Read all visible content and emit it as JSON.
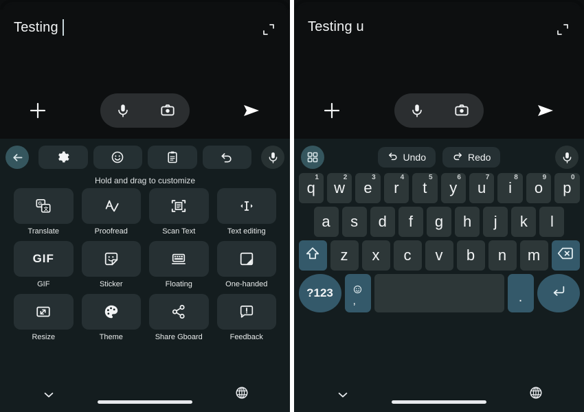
{
  "panels": {
    "left": {
      "compose": {
        "text": "Testing",
        "expand_icon": "expand-diagonal-icon",
        "plus_icon": "plus-icon",
        "mic_icon": "microphone-icon",
        "camera_icon": "camera-icon",
        "send_icon": "send-arrow-icon"
      },
      "toolbar": {
        "back_icon": "arrow-back-icon",
        "items": [
          {
            "icon": "gear-icon",
            "name": "settings"
          },
          {
            "icon": "emoji-icon",
            "name": "emoji"
          },
          {
            "icon": "clipboard-icon",
            "name": "clipboard"
          },
          {
            "icon": "undo-icon",
            "name": "undo"
          }
        ],
        "mic_icon": "microphone-icon"
      },
      "hint": "Hold and drag to customize",
      "tiles": [
        {
          "label": "Translate",
          "icon": "translate-icon"
        },
        {
          "label": "Proofread",
          "icon": "proofread-icon"
        },
        {
          "label": "Scan Text",
          "icon": "scan-text-icon"
        },
        {
          "label": "Text editing",
          "icon": "text-editing-icon"
        },
        {
          "label": "GIF",
          "icon": "gif-icon"
        },
        {
          "label": "Sticker",
          "icon": "sticker-icon"
        },
        {
          "label": "Floating",
          "icon": "floating-keyboard-icon"
        },
        {
          "label": "One-handed",
          "icon": "one-handed-icon"
        },
        {
          "label": "Resize",
          "icon": "resize-icon"
        },
        {
          "label": "Theme",
          "icon": "theme-palette-icon"
        },
        {
          "label": "Share Gboard",
          "icon": "share-icon"
        },
        {
          "label": "Feedback",
          "icon": "feedback-icon"
        }
      ],
      "navbar": {
        "chevron_icon": "chevron-down-icon",
        "globe_icon": "globe-icon"
      }
    },
    "right": {
      "compose": {
        "text": "Testing u",
        "expand_icon": "expand-diagonal-icon",
        "plus_icon": "plus-icon",
        "mic_icon": "microphone-icon",
        "camera_icon": "camera-icon",
        "send_icon": "send-arrow-icon"
      },
      "toolbar": {
        "grid_icon": "app-grid-icon",
        "undo_label": "Undo",
        "undo_icon": "undo-icon",
        "redo_label": "Redo",
        "redo_icon": "redo-icon",
        "mic_icon": "microphone-icon"
      },
      "keyboard": {
        "row1": [
          {
            "key": "q",
            "sup": "1"
          },
          {
            "key": "w",
            "sup": "2"
          },
          {
            "key": "e",
            "sup": "3"
          },
          {
            "key": "r",
            "sup": "4"
          },
          {
            "key": "t",
            "sup": "5"
          },
          {
            "key": "y",
            "sup": "6"
          },
          {
            "key": "u",
            "sup": "7"
          },
          {
            "key": "i",
            "sup": "8"
          },
          {
            "key": "o",
            "sup": "9"
          },
          {
            "key": "p",
            "sup": "0"
          }
        ],
        "row2": [
          "a",
          "s",
          "d",
          "f",
          "g",
          "h",
          "j",
          "k",
          "l"
        ],
        "row3": {
          "shift_icon": "shift-up-arrow-icon",
          "letters": [
            "z",
            "x",
            "c",
            "v",
            "b",
            "n",
            "m"
          ],
          "backspace_icon": "backspace-icon"
        },
        "row4": {
          "symbols_label": "?123",
          "emoji_icon": "emoji-icon",
          "comma": ",",
          "space": "",
          "period": ".",
          "enter_icon": "enter-return-icon"
        }
      },
      "navbar": {
        "chevron_icon": "chevron-down-icon",
        "globe_icon": "globe-icon"
      }
    }
  },
  "colors": {
    "background": "#0d0f10",
    "keyboard_bg": "#141d1f",
    "key_bg": "#2d3738",
    "accent_key": "#34596a",
    "accent_circle": "#35565e",
    "tile_bg": "#263033",
    "text": "#f1f3f4"
  }
}
